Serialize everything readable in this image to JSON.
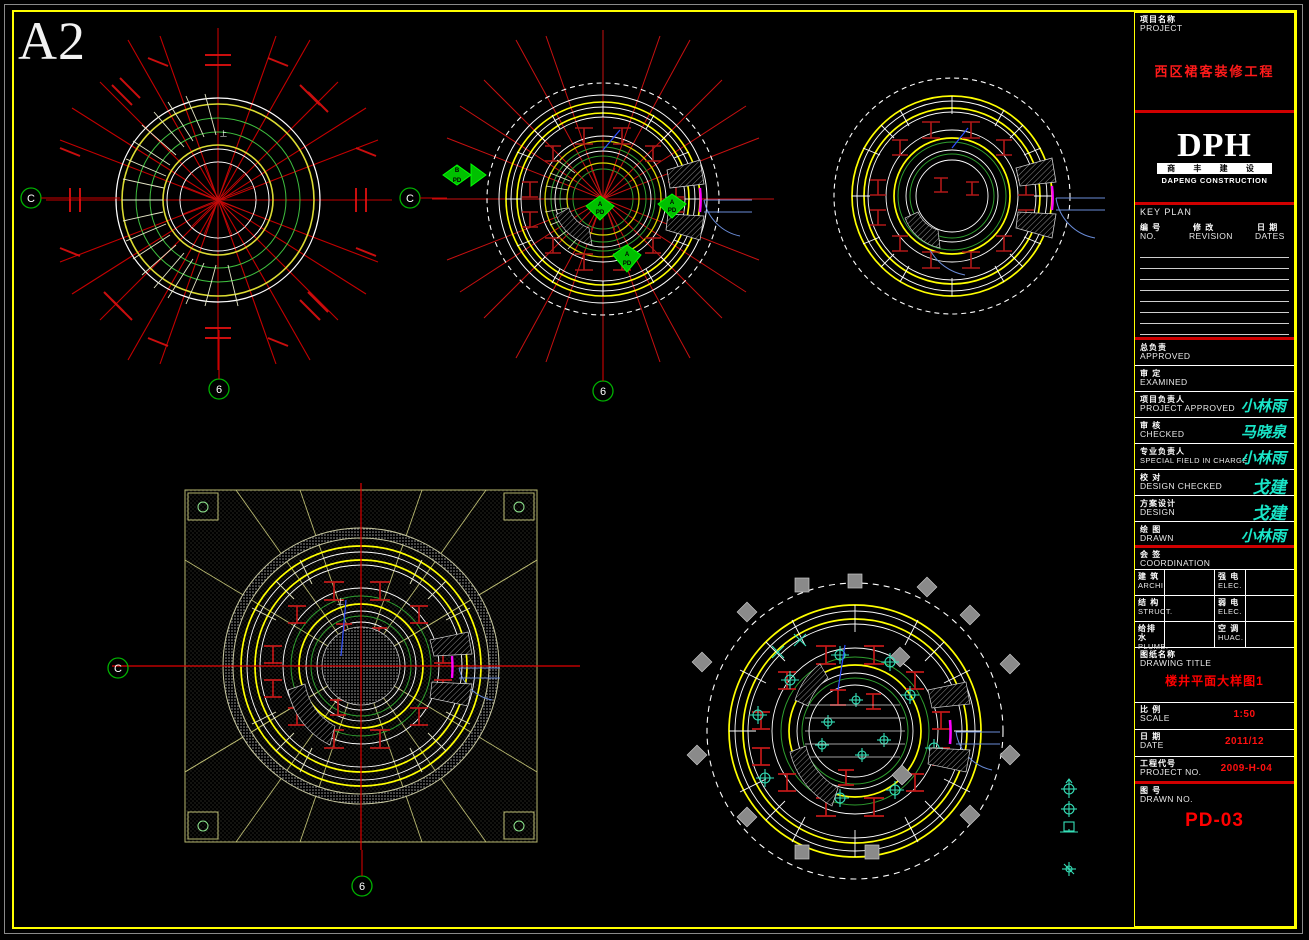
{
  "sheet": {
    "size_label": "A2",
    "background": "#000000",
    "frame_color": "#ffff00",
    "outer_frame_color": "#8a8a8a"
  },
  "title_block": {
    "project": {
      "label_cn": "项目名称",
      "label_en": "PROJECT",
      "value": "西区裙客装修工程"
    },
    "logo": {
      "mark": "DPH",
      "name_cn": "商 丰 建 设",
      "name_en": "DAPENG CONSTRUCTION"
    },
    "key_plan": {
      "label": "KEY PLAN"
    },
    "revision": {
      "no_cn": "编 号",
      "no_en": "NO.",
      "rev_cn": "修 改",
      "rev_en": "REVISION",
      "date_cn": "日 期",
      "date_en": "DATES",
      "rows": 8
    },
    "approvals": [
      {
        "cn": "总负责",
        "en": "APPROVED",
        "sign": ""
      },
      {
        "cn": "审  定",
        "en": "EXAMINED",
        "sign": ""
      },
      {
        "cn": "项目负责人",
        "en": "PROJECT APPROVED",
        "sign": "小林雨"
      },
      {
        "cn": "审  核",
        "en": "CHECKED",
        "sign": "马晓泉"
      },
      {
        "cn": "专业负责人",
        "en": "SPECIAL FIELD IN CHARGE",
        "sign": "小林雨"
      },
      {
        "cn": "校  对",
        "en": "DESIGN CHECKED",
        "sign": "戈建"
      },
      {
        "cn": "方案设计",
        "en": "DESIGN",
        "sign": "戈建"
      },
      {
        "cn": "绘  图",
        "en": "DRAWN",
        "sign": "小林雨"
      }
    ],
    "coordination": {
      "cn": "会  签",
      "en": "COORDINATION"
    },
    "coordination_rows": [
      {
        "l_cn": "建  筑",
        "l_en": "ARCHI.",
        "l_val": "",
        "r_cn": "强  电",
        "r_en": "ELEC.",
        "r_val": ""
      },
      {
        "l_cn": "结  构",
        "l_en": "STRUCT.",
        "l_val": "",
        "r_cn": "弱  电",
        "r_en": "ELEC.",
        "r_val": ""
      },
      {
        "l_cn": "给排水",
        "l_en": "PLUMB.",
        "l_val": "",
        "r_cn": "空  调",
        "r_en": "HUAC.",
        "r_val": ""
      }
    ],
    "drawing_title": {
      "cn": "图纸名称",
      "en": "DRAWING TITLE",
      "value": "楼井平面大样图1"
    },
    "scale": {
      "cn": "比  例",
      "en": "SCALE",
      "value": "1:50"
    },
    "date": {
      "cn": "日  期",
      "en": "DATE",
      "value": "2011/12"
    },
    "project_no": {
      "cn": "工程代号",
      "en": "PROJECT NO.",
      "value": "2009-H-04"
    },
    "drawn_no": {
      "cn": "图  号",
      "en": "DRAWN NO.",
      "value": "PD-03"
    }
  },
  "drawings": [
    {
      "name": "spiral-stair-plan-1",
      "grid_bubbles": [
        {
          "label": "C",
          "pos": "left"
        },
        {
          "label": "6",
          "pos": "bottom"
        }
      ],
      "note": "radial spiral stair plan with red centerline grid"
    },
    {
      "name": "atrium-plan-2",
      "grid_bubbles": [
        {
          "label": "C",
          "pos": "left"
        },
        {
          "label": "6",
          "pos": "bottom"
        }
      ],
      "detail_markers": [
        "B",
        "A",
        "A"
      ]
    },
    {
      "name": "atrium-plan-3",
      "grid_bubbles": []
    },
    {
      "name": "ceiling-plan-4",
      "grid_bubbles": [
        {
          "label": "C",
          "pos": "left"
        },
        {
          "label": "6",
          "pos": "bottom"
        }
      ]
    },
    {
      "name": "lighting-plan-5",
      "grid_bubbles": []
    }
  ],
  "legend_symbols": [
    {
      "name": "downlight-symbol"
    },
    {
      "name": "spotlight-symbol"
    },
    {
      "name": "wall-fixture-symbol"
    },
    {
      "name": "small-light-symbol"
    }
  ],
  "colors": {
    "frame": "#ffff00",
    "centerline": "#ff0000",
    "structure": "#ffffff",
    "finish": "#ffff00",
    "grid_bubble": "#00c000",
    "marker": "#00d000",
    "accent_magenta": "#ff00ff",
    "accent_blue": "#3050ff",
    "title_text": "#ff0000"
  }
}
